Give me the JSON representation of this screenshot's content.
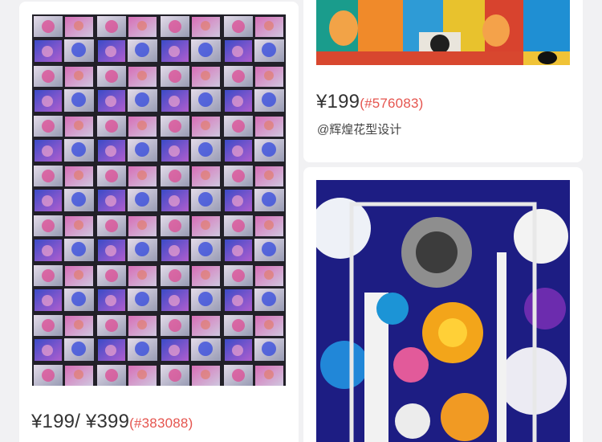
{
  "products": [
    {
      "image_alt": "floral block pattern",
      "price": "¥199/ ¥399",
      "code": "(#383088)"
    },
    {
      "image_alt": "cartoon cats pattern",
      "price": "¥199",
      "code": "(#576083)",
      "author": "@辉煌花型设计"
    },
    {
      "image_alt": "tropical flowers striped frame pattern"
    }
  ],
  "colors": {
    "background": "#f1f1f3",
    "card": "#ffffff",
    "price_text": "#333333",
    "code_text": "#e5554f"
  }
}
